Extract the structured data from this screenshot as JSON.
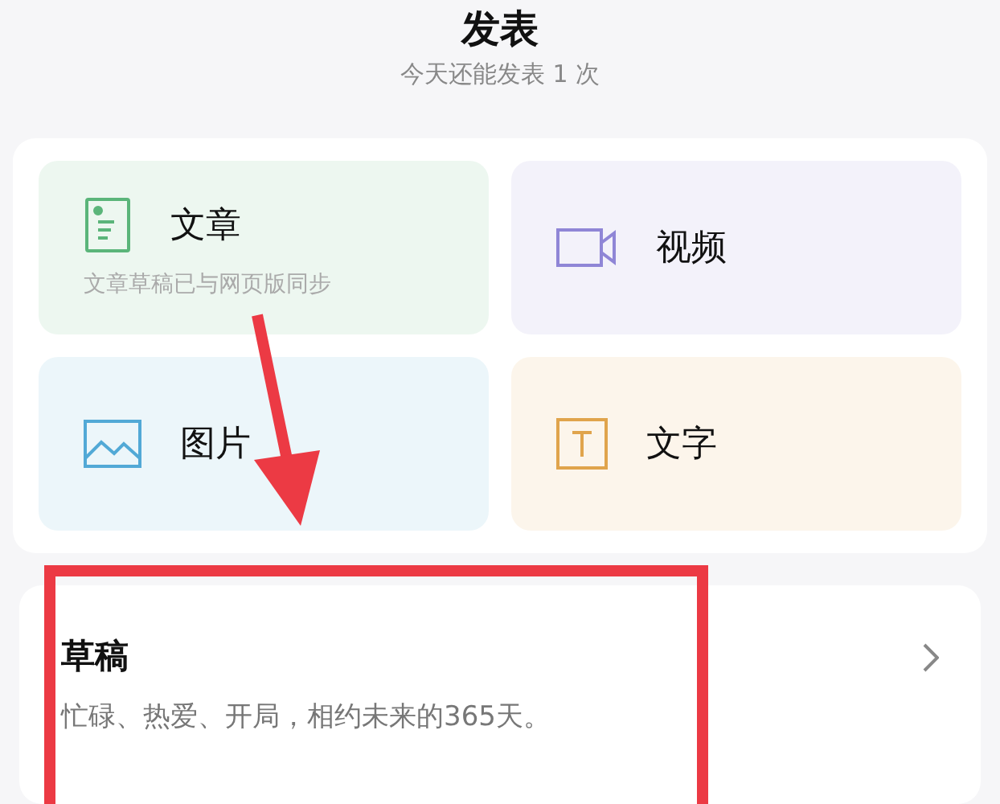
{
  "header": {
    "title": "发表",
    "subtitle": "今天还能发表 1 次"
  },
  "tiles": [
    {
      "kind": "article",
      "label": "文章",
      "note": "文章草稿已与网页版同步",
      "color": "#5bb57a"
    },
    {
      "kind": "video",
      "label": "视频",
      "color": "#8f86d6"
    },
    {
      "kind": "image",
      "label": "图片",
      "color": "#52a9d6"
    },
    {
      "kind": "text",
      "label": "文字",
      "color": "#e0a44c"
    }
  ],
  "drafts": {
    "title": "草稿",
    "description": "忙碌、热爱、开局，相约未来的365天。"
  }
}
